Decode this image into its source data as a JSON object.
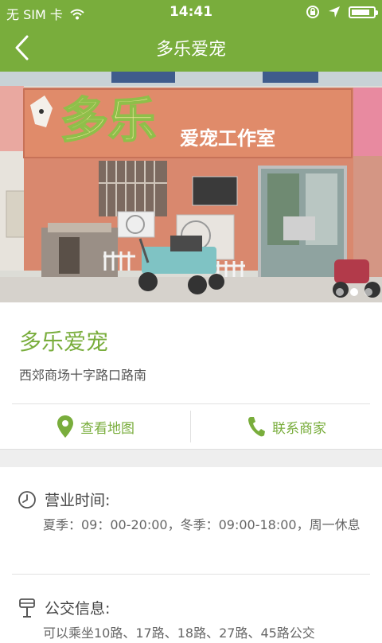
{
  "status_bar": {
    "carrier": "无 SIM 卡",
    "time": "14:41",
    "battery_level": 0.85
  },
  "nav": {
    "title": "多乐爱宠"
  },
  "photo": {
    "sign_big": "多乐",
    "sign_small": "爱宠工作室",
    "dots_count": 3,
    "active_dot": 1
  },
  "shop": {
    "name": "多乐爱宠",
    "address": "西郊商场十字路口路南"
  },
  "actions": {
    "map_label": "查看地图",
    "contact_label": "联系商家"
  },
  "hours": {
    "heading": "营业时间:",
    "text": "夏季：09：00-20:00，冬季：09:00-18:00，周一休息"
  },
  "bus": {
    "heading": "公交信息:",
    "text": "可以乘坐10路、17路、18路、27路、45路公交"
  },
  "colors": {
    "accent": "#79ad3c",
    "wall": "#d9886e",
    "sign": "#e08b6a"
  },
  "icons": {
    "back": "chevron-left-icon",
    "map": "map-pin-icon",
    "phone": "phone-icon",
    "clock": "clock-icon",
    "bus": "bus-stop-icon"
  }
}
